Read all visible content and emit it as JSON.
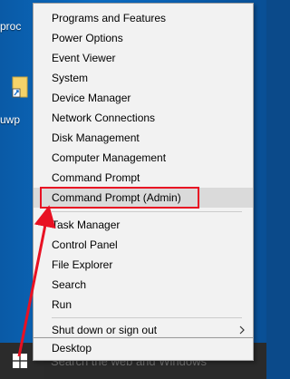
{
  "desktop": {
    "label_top": "proc",
    "label_mid": "uwp"
  },
  "menu": {
    "items": [
      {
        "label": "Programs and Features"
      },
      {
        "label": "Power Options"
      },
      {
        "label": "Event Viewer"
      },
      {
        "label": "System"
      },
      {
        "label": "Device Manager"
      },
      {
        "label": "Network Connections"
      },
      {
        "label": "Disk Management"
      },
      {
        "label": "Computer Management"
      },
      {
        "label": "Command Prompt"
      },
      {
        "label": "Command Prompt (Admin)"
      },
      {
        "label": "Task Manager"
      },
      {
        "label": "Control Panel"
      },
      {
        "label": "File Explorer"
      },
      {
        "label": "Search"
      },
      {
        "label": "Run"
      },
      {
        "label": "Shut down or sign out"
      },
      {
        "label": "Desktop"
      }
    ]
  },
  "taskbar": {
    "search_placeholder": "Search the web and Windows"
  },
  "colors": {
    "highlight": "#e81123",
    "hover": "#dadada"
  },
  "icons": {
    "submenu": "chevron-right-icon",
    "start": "windows-logo-icon"
  }
}
